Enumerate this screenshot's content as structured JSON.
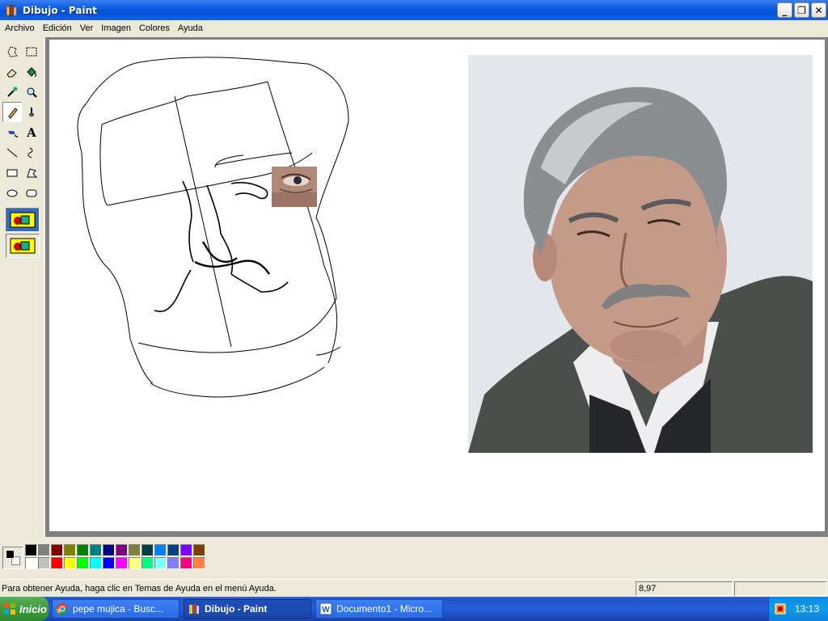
{
  "window": {
    "title": "Dibujo - Paint"
  },
  "menu": {
    "items": [
      "Archivo",
      "Edición",
      "Ver",
      "Imagen",
      "Colores",
      "Ayuda"
    ]
  },
  "tools": [
    {
      "name": "free-select",
      "icon": "free-select-icon"
    },
    {
      "name": "rect-select",
      "icon": "rect-select-icon"
    },
    {
      "name": "eraser",
      "icon": "eraser-icon"
    },
    {
      "name": "fill",
      "icon": "fill-bucket-icon"
    },
    {
      "name": "pick-color",
      "icon": "eyedropper-icon"
    },
    {
      "name": "magnifier",
      "icon": "magnifier-icon"
    },
    {
      "name": "pencil",
      "icon": "pencil-icon"
    },
    {
      "name": "brush",
      "icon": "brush-icon"
    },
    {
      "name": "airbrush",
      "icon": "airbrush-icon"
    },
    {
      "name": "text",
      "icon": "text-icon",
      "glyph": "A"
    },
    {
      "name": "line",
      "icon": "line-icon"
    },
    {
      "name": "curve",
      "icon": "curve-icon"
    },
    {
      "name": "rectangle",
      "icon": "rectangle-icon"
    },
    {
      "name": "polygon",
      "icon": "polygon-icon"
    },
    {
      "name": "ellipse",
      "icon": "ellipse-icon"
    },
    {
      "name": "rounded-rect",
      "icon": "rounded-rect-icon"
    }
  ],
  "palette": {
    "foreground": "#000000",
    "background": "#ffffff",
    "row1": [
      "#000000",
      "#808080",
      "#800000",
      "#808000",
      "#008000",
      "#008080",
      "#000080",
      "#800080",
      "#808040",
      "#004040",
      "#0080ff",
      "#004080",
      "#8000ff",
      "#804000"
    ],
    "row2": [
      "#ffffff",
      "#c0c0c0",
      "#ff0000",
      "#ffff00",
      "#00ff00",
      "#00ffff",
      "#0000ff",
      "#ff00ff",
      "#ffff80",
      "#00ff80",
      "#80ffff",
      "#8080ff",
      "#ff0080",
      "#ff8040"
    ]
  },
  "status": {
    "help": "Para obtener Ayuda, haga clic en Temas de Ayuda en el menú Ayuda.",
    "coords": "8,97",
    "size": ""
  },
  "taskbar": {
    "start": "Inicio",
    "tasks": [
      "pepe mujica - Busc...",
      "Dibujo - Paint",
      "Documento1 - Micro..."
    ],
    "clock": "13:13"
  }
}
